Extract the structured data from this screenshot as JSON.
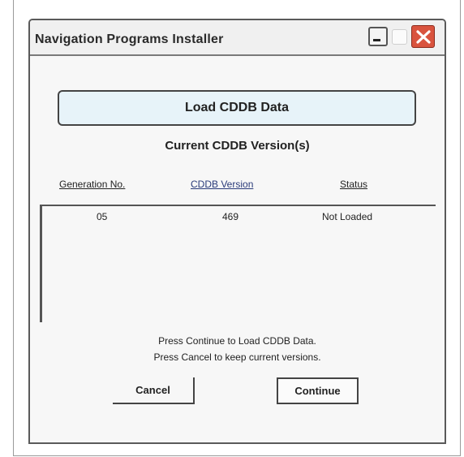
{
  "window": {
    "title": "Navigation Programs Installer"
  },
  "main": {
    "load_button_label": "Load CDDB Data",
    "section_title": "Current CDDB Version(s)",
    "columns": [
      "Generation No.",
      "CDDB Version",
      "Status"
    ],
    "rows": [
      [
        "05",
        "469",
        "Not Loaded"
      ]
    ],
    "message_line1": "Press Continue to Load CDDB Data.",
    "message_line2": "Press Cancel to keep current versions.",
    "cancel_label": "Cancel",
    "continue_label": "Continue"
  },
  "colors": {
    "load_button_bg": "#e7f3f9",
    "close_button": "#d9533e",
    "link_header": "#2a3b7a"
  },
  "icons": {
    "minimize": "minimize-icon",
    "maximize": "maximize-icon",
    "close": "close-icon"
  }
}
